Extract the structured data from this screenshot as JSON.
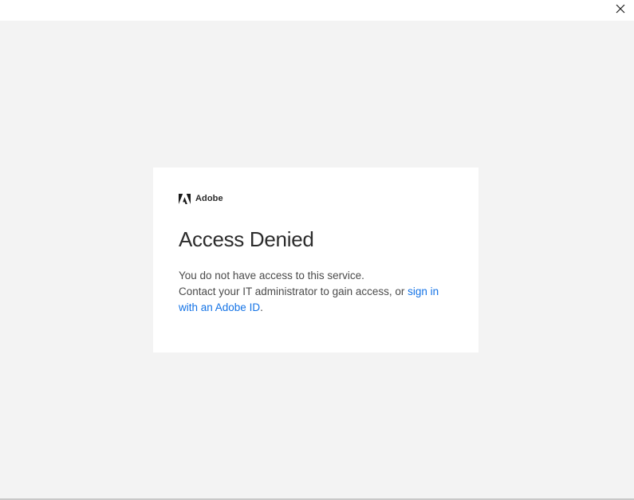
{
  "window": {
    "close_icon": "close-icon"
  },
  "brand": {
    "logo_icon": "adobe-logo-icon",
    "name": "Adobe"
  },
  "dialog": {
    "title": "Access Denied",
    "line1": "You do not have access to this service.",
    "line2_prefix": "Contact your IT administrator to gain access, or ",
    "link_text": "sign in with an Adobe ID",
    "line2_suffix": "."
  },
  "colors": {
    "background": "#f3f3f3",
    "card": "#ffffff",
    "link": "#1473e6",
    "text": "#2c2c2c"
  }
}
